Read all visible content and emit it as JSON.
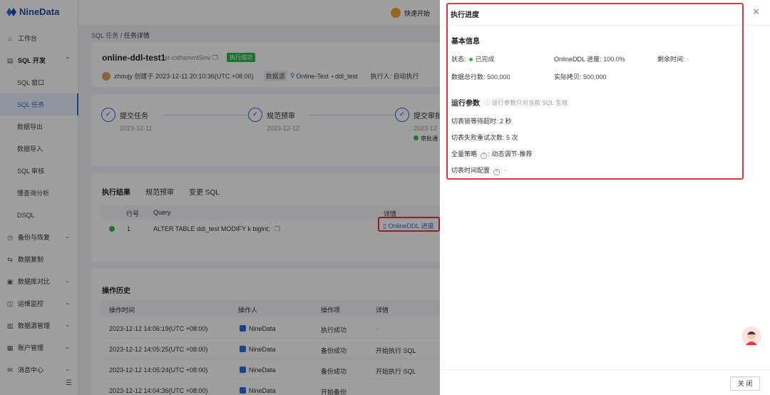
{
  "app": {
    "logo": "NineData",
    "quick_start": "快速开始"
  },
  "sidebar": {
    "items": [
      {
        "label": "工作台",
        "icon": "home-icon"
      },
      {
        "label": "SQL 开发",
        "icon": "sql-icon",
        "expanded": true
      },
      {
        "label": "SQL 窗口"
      },
      {
        "label": "SQL 任务",
        "active": true
      },
      {
        "label": "数据导出"
      },
      {
        "label": "数据导入"
      },
      {
        "label": "SQL 审核"
      },
      {
        "label": "慢查询分析"
      },
      {
        "label": "DSQL"
      },
      {
        "label": "备份与恢复",
        "icon": "backup-icon"
      },
      {
        "label": "数据复制",
        "icon": "replicate-icon"
      },
      {
        "label": "数据库对比",
        "icon": "compare-icon"
      },
      {
        "label": "运维监控",
        "icon": "monitor-icon"
      },
      {
        "label": "数据源管理",
        "icon": "datasource-icon"
      },
      {
        "label": "账户管理",
        "icon": "account-icon"
      },
      {
        "label": "消息中心",
        "icon": "message-icon"
      }
    ]
  },
  "breadcrumb": {
    "parent": "SQL 任务",
    "sep": "/",
    "current": "任务详情"
  },
  "task": {
    "name": "online-ddl-test1",
    "id": "st-cxlhsmmt5inv",
    "status": "执行成功",
    "creator": "zhoujy 创建于 2023-12-11 20:10:36(UTC +08:00)",
    "datasource_label": "数据源",
    "datasource": "Online-Test",
    "db": "ddl_test",
    "executor": "执行人: 自动执行"
  },
  "steps": [
    {
      "title": "提交任务",
      "date": "2023-12-11"
    },
    {
      "title": "规范预审",
      "date": "2023-12-12"
    },
    {
      "title": "提交审批",
      "date": "2023-12"
    }
  ],
  "approve_text": "审批通",
  "result": {
    "tabs": [
      "执行结果",
      "规范预审",
      "变更 SQL"
    ],
    "headers": {
      "no": "行号",
      "query": "Query",
      "detail": "详情"
    },
    "rows": [
      {
        "no": "1",
        "query": "ALTER TABLE ddl_test MODIFY k bigint;",
        "detail": "OnlineDDL 进度"
      }
    ]
  },
  "history": {
    "title": "操作历史",
    "headers": {
      "time": "操作时间",
      "user": "操作人",
      "action": "操作项",
      "detail": "详情"
    },
    "rows": [
      {
        "time": "2023-12-12 14:06:19(UTC +08:00)",
        "user": "NineData",
        "action": "执行成功",
        "detail": "-"
      },
      {
        "time": "2023-12-12 14:05:25(UTC +08:00)",
        "user": "NineData",
        "action": "备份成功",
        "detail": "开始执行 SQL"
      },
      {
        "time": "2023-12-12 14:05:24(UTC +08:00)",
        "user": "NineData",
        "action": "备份成功",
        "detail": "开始执行 SQL"
      },
      {
        "time": "2023-12-12 14:04:36(UTC +08:00)",
        "user": "NineData",
        "action": "开始备份",
        "detail": ""
      }
    ]
  },
  "drawer": {
    "title": "执行进度",
    "basic_title": "基本信息",
    "status_label": "状态:",
    "status_value": "已完成",
    "progress_label": "OnlineDDL 进度:",
    "progress_value": "100.0%",
    "remain_label": "剩余时间:",
    "remain_value": "-",
    "total_label": "数据总行数:",
    "total_value": "500,000",
    "copied_label": "实际拷贝:",
    "copied_value": "500,000",
    "params_title": "运行参数",
    "params_hint": "运行参数只对当前 SQL 生效",
    "lock_timeout": "切表锁等待超时: 2 秒",
    "retry": "切表失败重试次数: 5 次",
    "strategy_label": "全量策略",
    "strategy_value": ": 动态调节-推荐",
    "switch_label": "切表时间配置",
    "switch_value": ": -",
    "close_btn": "关 闭"
  }
}
